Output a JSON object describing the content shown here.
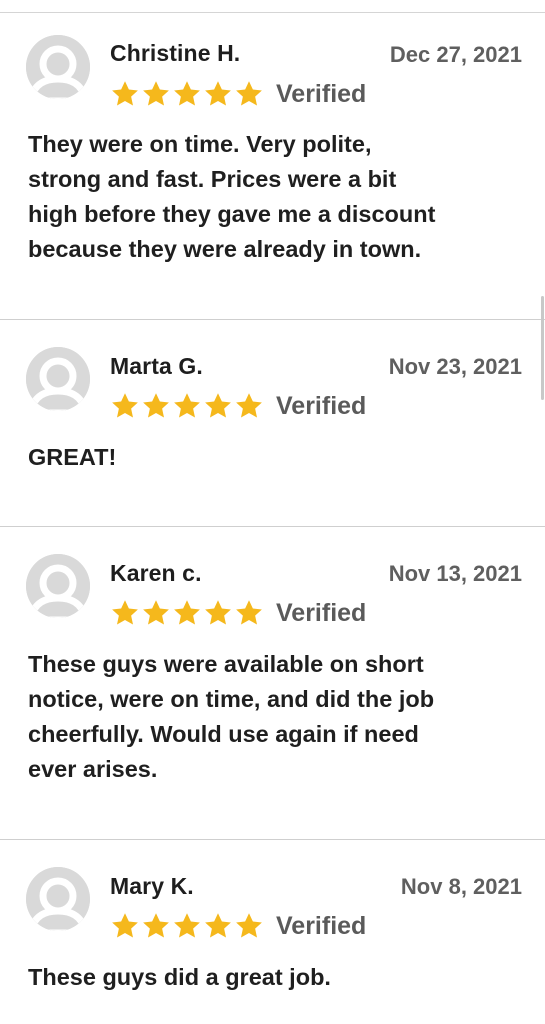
{
  "reviews": [
    {
      "name": "Christine H.",
      "date": "Dec 27, 2021",
      "rating": 5,
      "verified_label": "Verified",
      "text": "They were on time. Very polite,\nstrong and fast. Prices were a bit\nhigh before they gave me a discount\nbecause they were already in town."
    },
    {
      "name": "Marta G.",
      "date": "Nov 23, 2021",
      "rating": 5,
      "verified_label": "Verified",
      "text": "GREAT!"
    },
    {
      "name": "Karen c.",
      "date": "Nov 13, 2021",
      "rating": 5,
      "verified_label": "Verified",
      "text": "These guys were available on short\nnotice, were on time, and did the job\ncheerfully.  Would use again if need\never arises."
    },
    {
      "name": "Mary K.",
      "date": "Nov 8, 2021",
      "rating": 5,
      "verified_label": "Verified",
      "text": "These guys did a great job."
    }
  ],
  "icons": {
    "avatar": "user-placeholder-icon",
    "star": "star-icon"
  },
  "colors": {
    "star": "#f5b81c",
    "avatar_bg": "#d9d9d9",
    "avatar_fg": "#ffffff",
    "date": "#5f5f5f",
    "verified": "#5a5a5a",
    "divider": "#cfcfcf"
  }
}
